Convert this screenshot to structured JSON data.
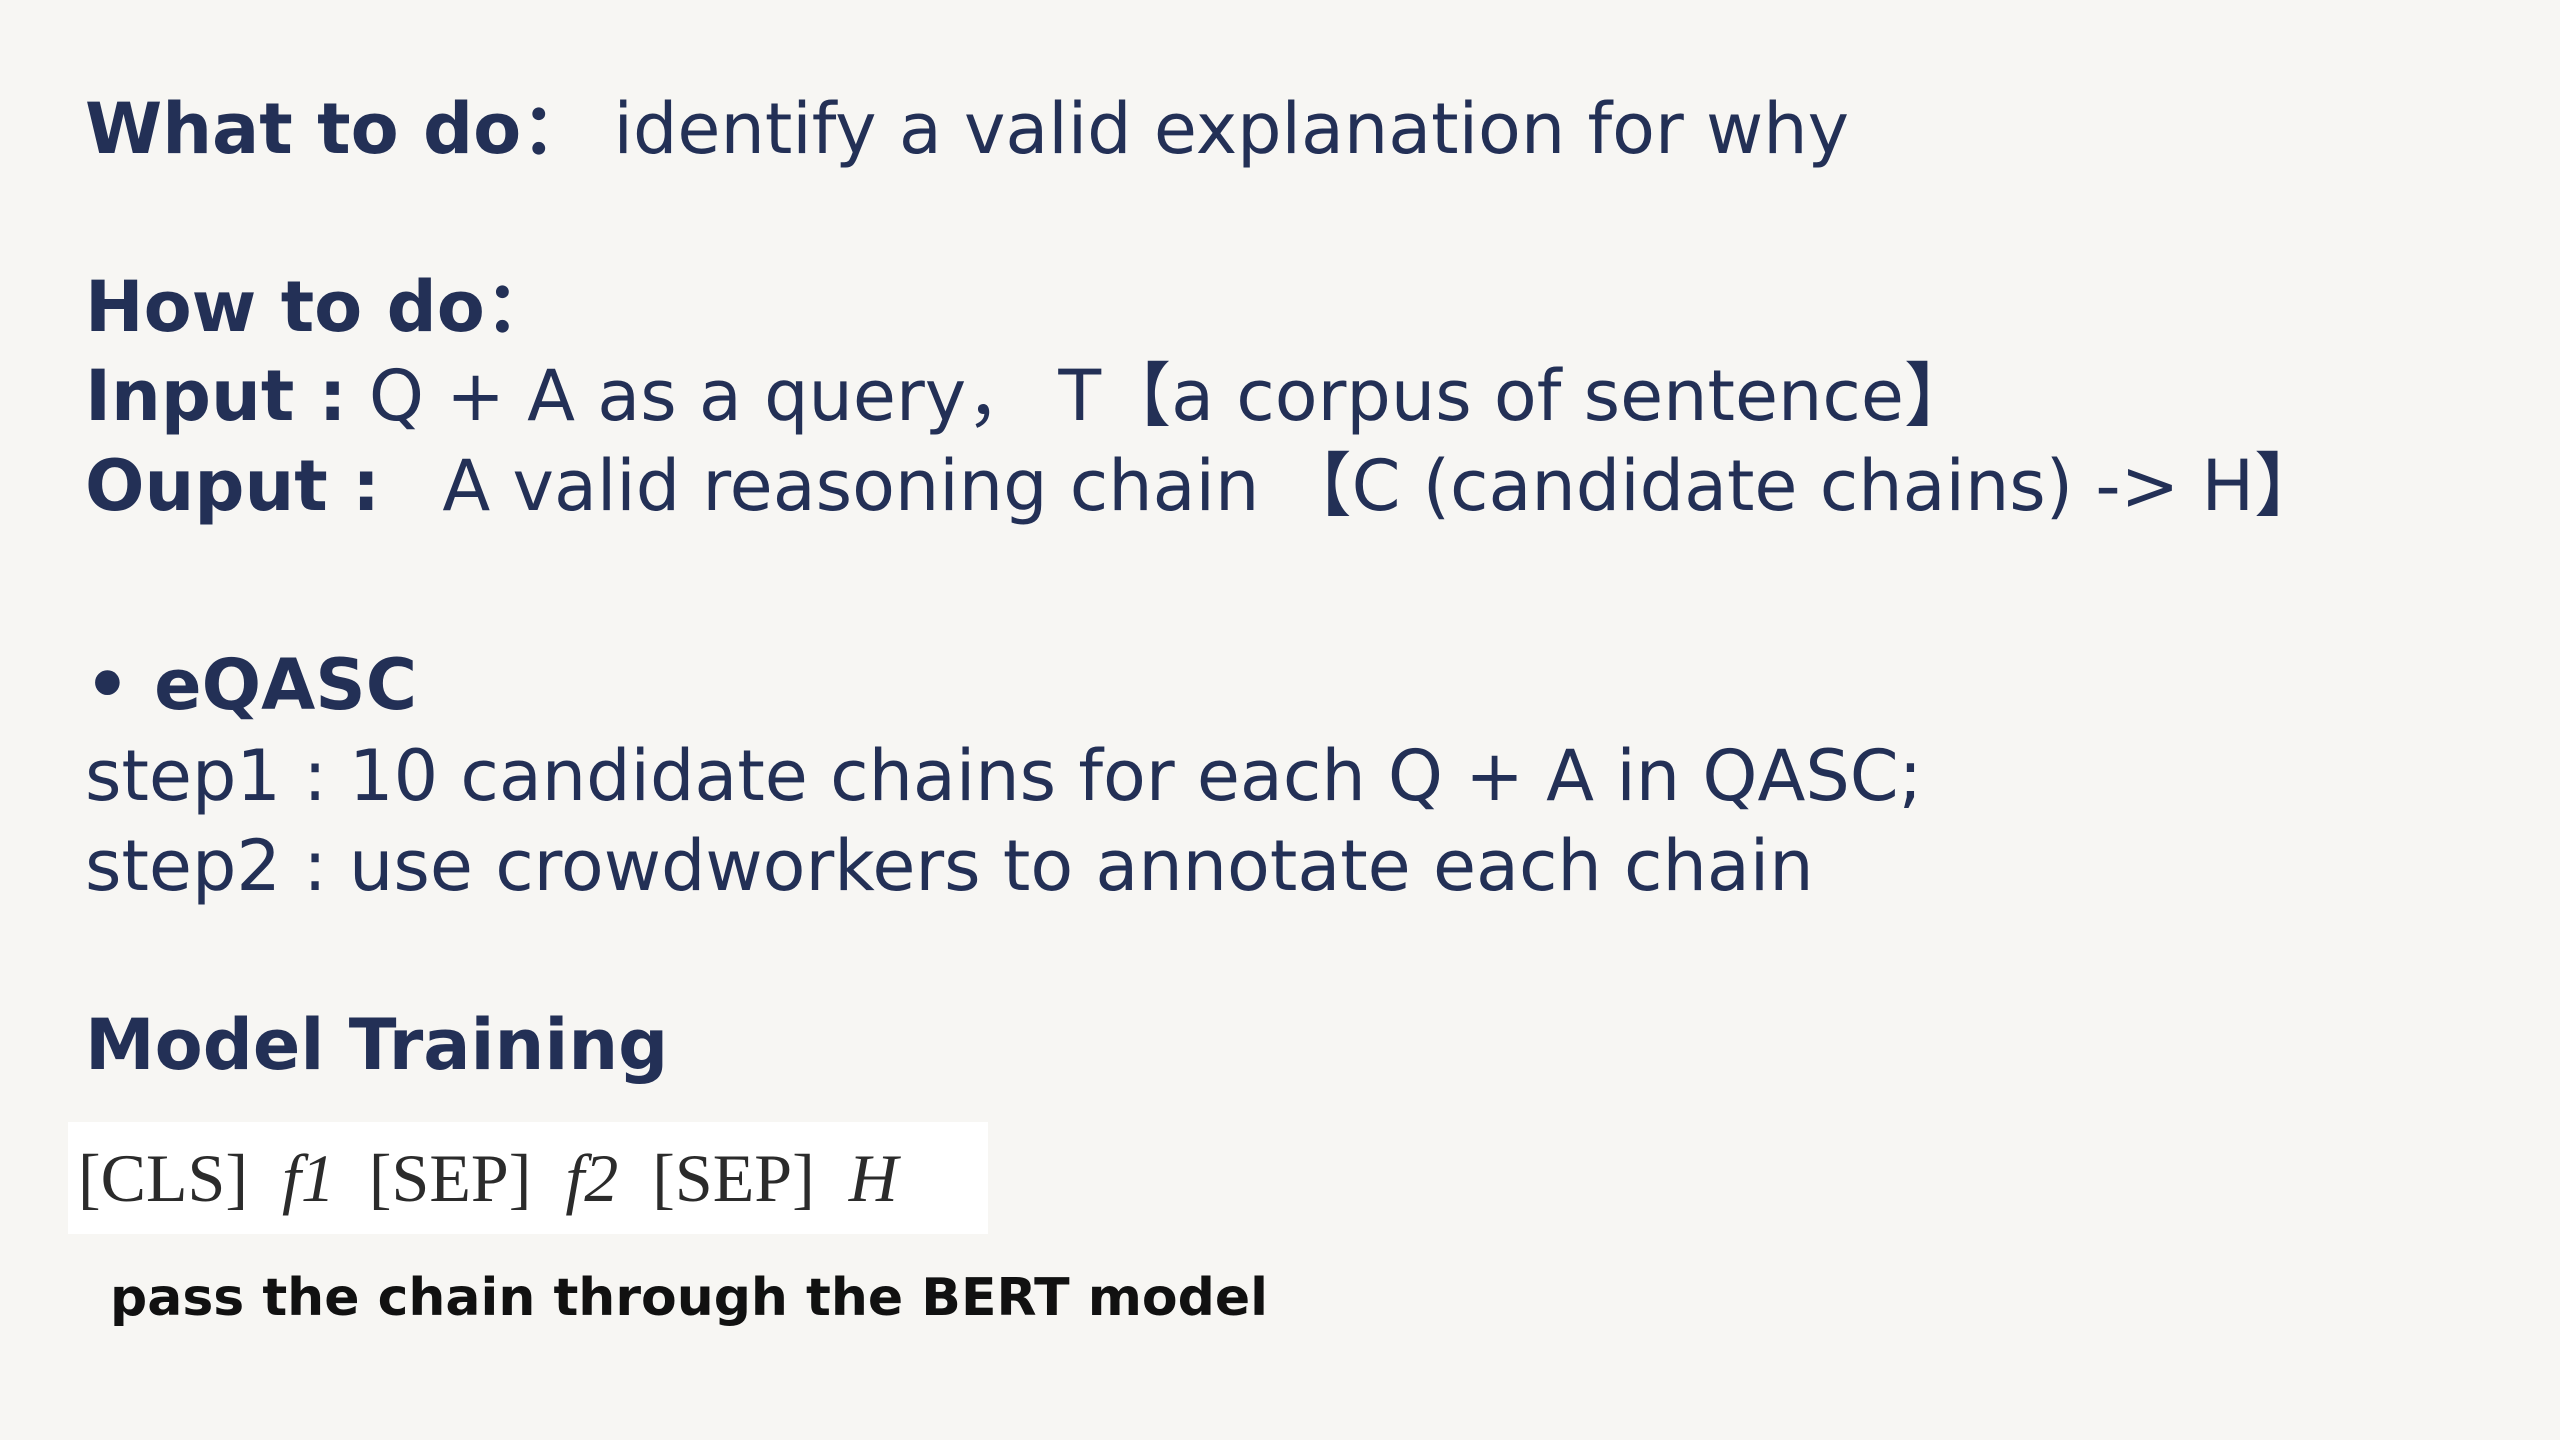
{
  "what": {
    "label": "What to do：",
    "text": "identify a valid explanation for why"
  },
  "how": {
    "label": "How to do：",
    "input_label": "Input :",
    "input_text": "Q + A as a query， T【a corpus of sentence】",
    "output_label": "Ouput :",
    "output_text": "A valid reasoning chain 【C (candidate chains) -> H】"
  },
  "eqasc": {
    "bullet": "•",
    "title": "eQASC",
    "step1": "step1 : 10 candidate chains for each Q + A in QASC;",
    "step2": "step2 : use crowdworkers to annotate each chain"
  },
  "model": {
    "title": "Model Training",
    "formula": [
      "[CLS]",
      "f1",
      "[SEP]",
      "f2",
      "[SEP]",
      "H"
    ],
    "caption": "pass the chain through the BERT model"
  }
}
